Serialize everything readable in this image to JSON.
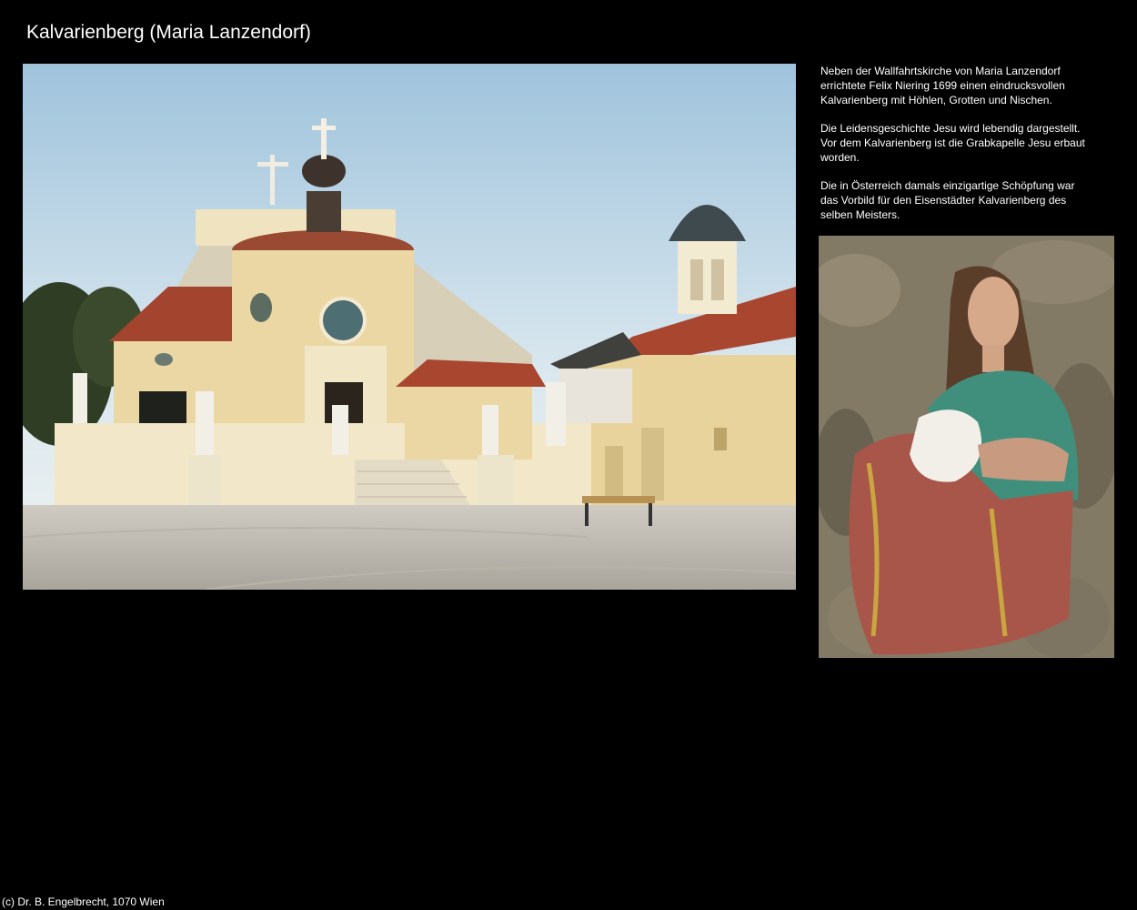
{
  "page": {
    "title": "Kalvarienberg (Maria Lanzendorf)",
    "footer": "(c) Dr. B. Engelbrecht, 1070 Wien"
  },
  "description": {
    "paragraph_1": "Neben der Wallfahrtskirche von Maria Lanzendorf errichtete Felix Niering 1699 einen eindrucksvollen Kalvarienberg mit Höhlen, Grotten und Nischen.",
    "paragraph_2": "Die Leidensgeschichte Jesu wird lebendig dargestellt. Vor dem Kalvarienberg ist die Grabkapelle Jesu erbaut worden.",
    "paragraph_3": "Die in Österreich damals einzigartige Schöpfung war das Vorbild für den Eisenstädter Kalvarienberg des selben Meisters."
  },
  "images": {
    "main": "photo-kalvarienberg-exterior",
    "side": "photo-painted-saint-statue"
  },
  "colors": {
    "background": "#000000",
    "text": "#ffffff"
  }
}
